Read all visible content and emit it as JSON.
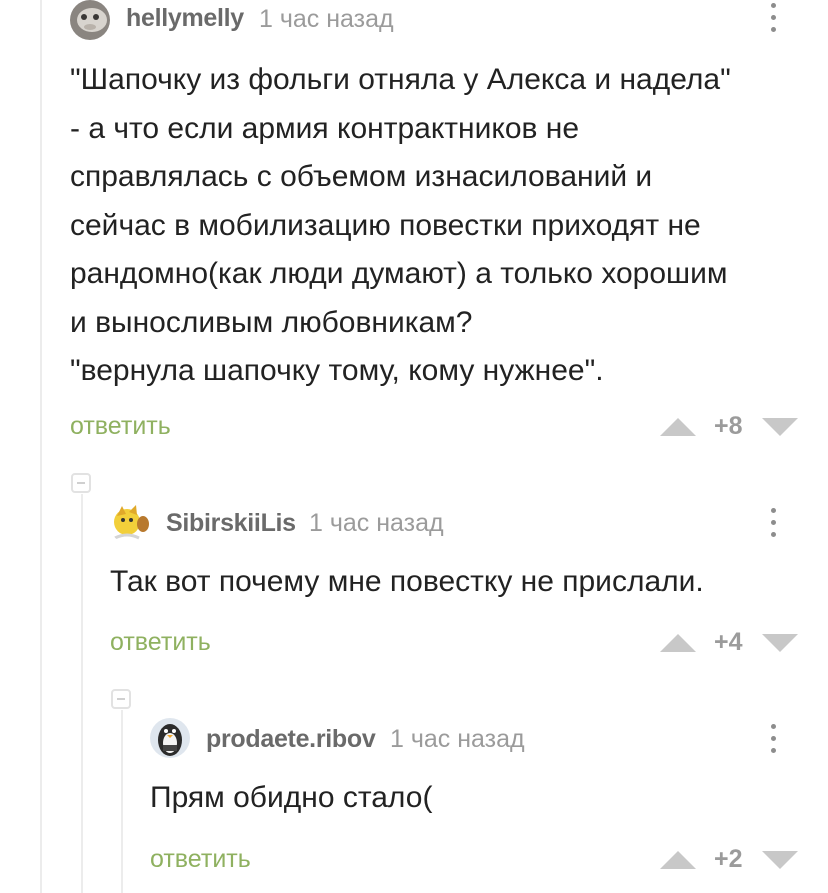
{
  "comments": [
    {
      "author": "hellymelly",
      "time": "1 час назад",
      "lines": [
        "\"Шапочку из фольги отняла у Алекса и надела\"",
        "- а что если армия контрактников не",
        "справлялась с объемом изнасилований и",
        "сейчас в мобилизацию повестки приходят не",
        "рандомно(как люди думают) а только хорошим",
        "и выносливым любовникам?",
        "\"вернула шапочку тому, кому нужнее\"."
      ],
      "reply_label": "ответить",
      "score": "+8"
    },
    {
      "author": "SibirskiiLis",
      "time": "1 час назад",
      "lines": [
        "Так вот почему мне повестку не прислали."
      ],
      "reply_label": "ответить",
      "score": "+4"
    },
    {
      "author": "prodaete.ribov",
      "time": "1 час назад",
      "lines": [
        "Прям обидно стало("
      ],
      "reply_label": "ответить",
      "score": "+2"
    }
  ],
  "colors": {
    "reply_green": "#8fb160",
    "meta_gray": "#9b9b9b",
    "thread_line": "#ececec"
  },
  "icons": [
    "more-vertical-icon",
    "collapse-icon",
    "upvote-icon",
    "downvote-icon"
  ]
}
